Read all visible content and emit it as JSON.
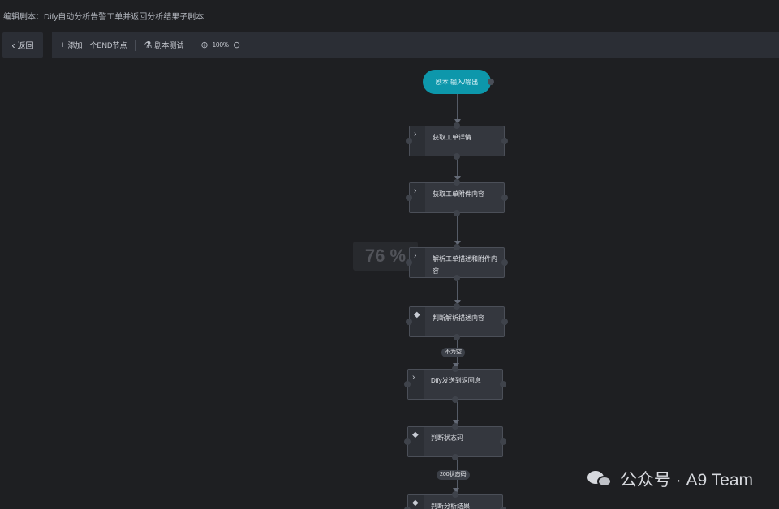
{
  "window": {
    "title": "编辑剧本：Dify自动分析告警工单并返回分析结果子剧本"
  },
  "toolbar": {
    "back_label": "返回",
    "add_end_label": "添加一个END节点",
    "test_label": "剧本测试",
    "zoom_level": "100%",
    "icons": {
      "back": "chevron-left-icon",
      "add": "plus-icon",
      "test": "flask-icon",
      "zoom_in": "zoom-in-icon",
      "zoom_out": "zoom-out-icon"
    }
  },
  "canvas": {
    "start_node_label": "剧本 输入/输出",
    "zoom_overlay": "76 %",
    "nodes": [
      {
        "label": "获取工单详情",
        "icon": "chevron-right-icon"
      },
      {
        "label": "获取工单附件内容",
        "icon": "chevron-right-icon"
      },
      {
        "label": "解析工单描述和附件内容",
        "icon": "chevron-right-icon"
      },
      {
        "label": "判断解析描述内容",
        "icon": "diamond-icon"
      },
      {
        "label": "Dify发送到返回息",
        "icon": "chevron-right-icon"
      },
      {
        "label": "判断状态码",
        "icon": "diamond-icon"
      },
      {
        "label": "判断分析结果",
        "icon": "diamond-icon"
      }
    ],
    "edge_labels": [
      "不为空",
      "200状态码"
    ]
  },
  "watermark": {
    "text": "公众号 · A9 Team"
  }
}
